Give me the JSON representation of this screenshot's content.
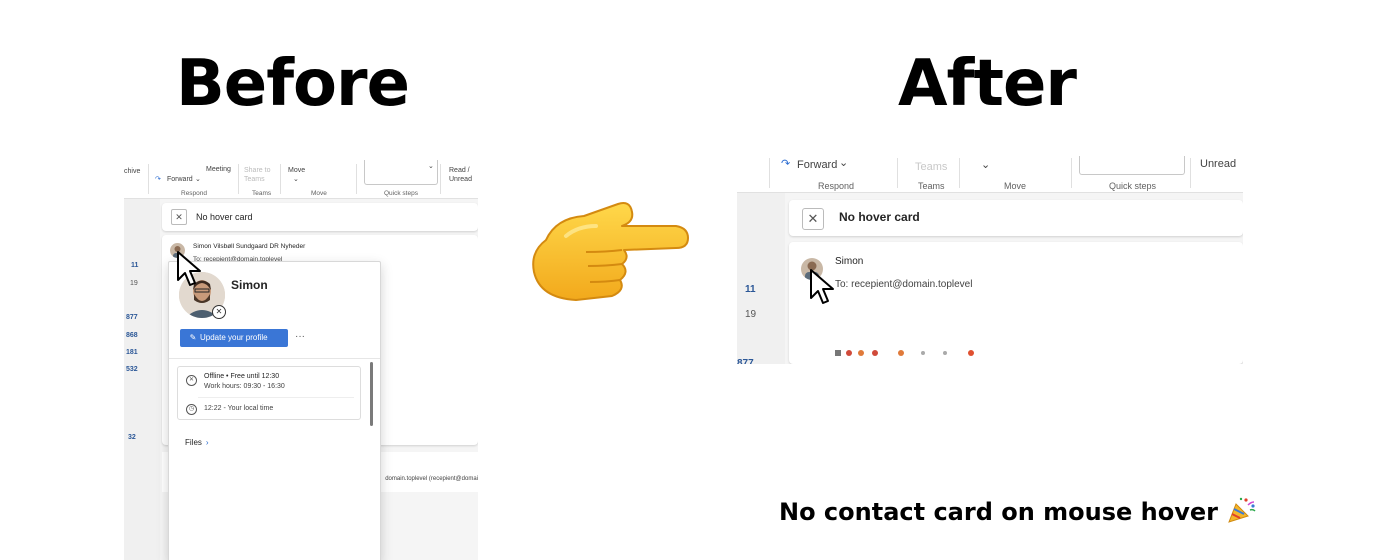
{
  "headings": {
    "before": "Before",
    "after": "After"
  },
  "caption": "No contact card on mouse hover",
  "icons": {
    "pointer": "backhand-index-pointing-right-emoji",
    "party": "party-popper-emoji"
  },
  "before": {
    "ribbon": {
      "archive": "chive",
      "meeting": "Meeting",
      "forward": "Forward",
      "share_to_teams": "Share to Teams",
      "move": "Move",
      "read_unread": "Read / Unread",
      "groups": {
        "respond": "Respond",
        "teams": "Teams",
        "move": "Move",
        "quick_steps": "Quick steps"
      }
    },
    "left_numbers": [
      "11",
      "19",
      "877",
      "868",
      "181",
      "532",
      "32"
    ],
    "no_hover_card": "No hover card",
    "sender": "Simon Vilsbøll Sundgaard DR Nyheder",
    "to_fragment": "To: recepient@domain.toplevel",
    "lower_address": "domain.toplevel (recepient@domai",
    "hover_card": {
      "name": "Simon",
      "update_profile": "Update your profile",
      "more": "···",
      "status": "Offline • Free until 12:30",
      "work_hours": "Work hours: 09:30 - 16:30",
      "local_time": "12:22 - Your local time",
      "files": "Files"
    }
  },
  "after": {
    "ribbon": {
      "forward": "Forward",
      "teams": "Teams",
      "unread": "Unread",
      "groups": {
        "respond": "Respond",
        "teams": "Teams",
        "move": "Move",
        "quick_steps": "Quick steps"
      }
    },
    "left_numbers": [
      "11",
      "19",
      "877"
    ],
    "no_hover_card": "No hover card",
    "sender": "Simon",
    "to": "To:  recepient@domain.toplevel"
  },
  "colors": {
    "accent_blue": "#3a76d6",
    "link_blue": "#2b5797"
  }
}
